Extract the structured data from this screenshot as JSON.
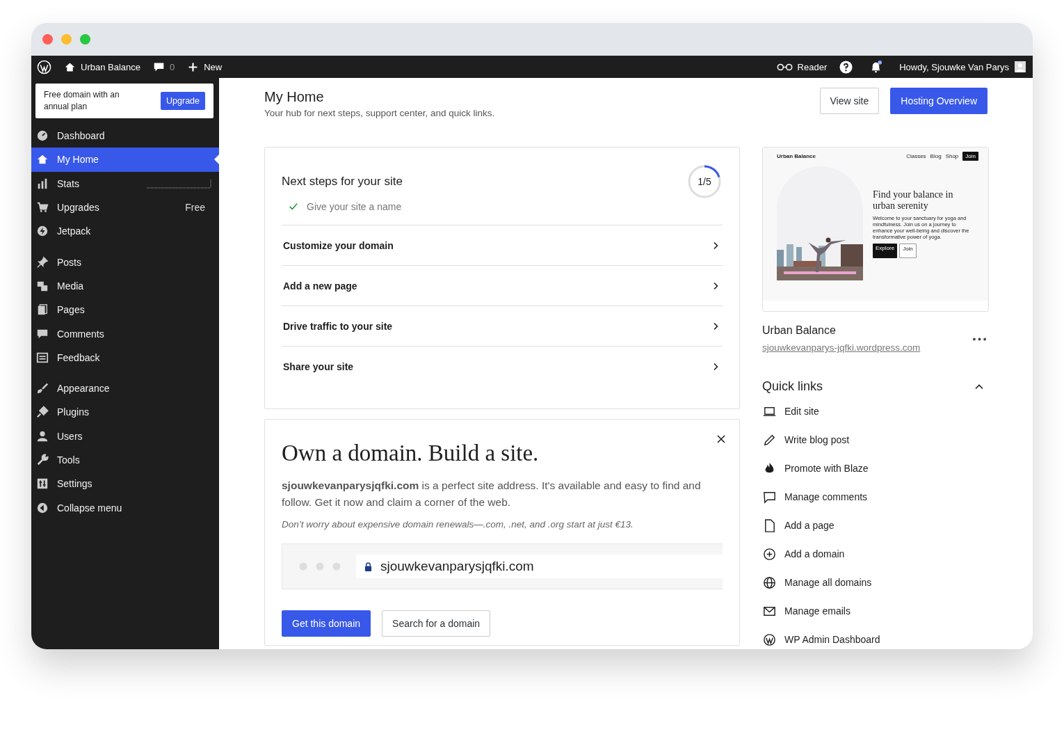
{
  "admin_bar": {
    "site": "Urban Balance",
    "comments": "0",
    "new": "New",
    "reader": "Reader",
    "greeting": "Howdy, Sjouwke Van Parys",
    "unread_notifications": true
  },
  "sidebar": {
    "promo": {
      "text": "Free domain with an annual plan",
      "button": "Upgrade"
    },
    "groups": [
      {
        "items": [
          {
            "label": "Dashboard",
            "selected": false,
            "kind": "plain"
          },
          {
            "label": "My Home",
            "selected": true,
            "kind": "plain"
          },
          {
            "label": "Stats",
            "selected": false,
            "kind": "sparkline"
          },
          {
            "label": "Upgrades",
            "selected": false,
            "kind": "badge",
            "badge": "Free"
          },
          {
            "label": "Jetpack",
            "selected": false,
            "kind": "plain"
          }
        ]
      },
      {
        "items": [
          {
            "label": "Posts",
            "selected": false,
            "kind": "plain"
          },
          {
            "label": "Media",
            "selected": false,
            "kind": "plain"
          },
          {
            "label": "Pages",
            "selected": false,
            "kind": "plain"
          },
          {
            "label": "Comments",
            "selected": false,
            "kind": "plain"
          },
          {
            "label": "Feedback",
            "selected": false,
            "kind": "plain"
          }
        ]
      },
      {
        "items": [
          {
            "label": "Appearance",
            "selected": false,
            "kind": "plain"
          },
          {
            "label": "Plugins",
            "selected": false,
            "kind": "plain"
          },
          {
            "label": "Users",
            "selected": false,
            "kind": "plain"
          },
          {
            "label": "Tools",
            "selected": false,
            "kind": "plain"
          },
          {
            "label": "Settings",
            "selected": false,
            "kind": "plain"
          },
          {
            "label": "Collapse menu",
            "selected": false,
            "kind": "plain"
          }
        ]
      }
    ]
  },
  "header": {
    "title": "My Home",
    "subtitle": "Your hub for next steps, support center, and quick links.",
    "buttons": [
      {
        "label": "View site",
        "primary": false
      },
      {
        "label": "Hosting Overview",
        "primary": true
      }
    ]
  },
  "next_steps": {
    "title": "Next steps for your site",
    "progress": "1/5",
    "level": 0.2,
    "completed": [
      {
        "label": "Give your site a name"
      }
    ],
    "steps": [
      {
        "label": "Customize your domain"
      },
      {
        "label": "Add a new page"
      },
      {
        "label": "Drive traffic to your site"
      },
      {
        "label": "Share your site"
      }
    ]
  },
  "domain_card": {
    "title": "Own a domain. Build a site.",
    "text": "**sjouwkevanparysjqfki.com** is a perfect site address. It's available and easy to find and follow. Get it now and claim a corner of the web.",
    "note": "Don’t worry about expensive domain renewals—.com, .net, and .org start at just €13.",
    "address": "sjouwkevanparysjqfki.com",
    "buttons": [
      {
        "label": "Get this domain",
        "primary": true
      },
      {
        "label": "Search for a domain",
        "primary": false
      }
    ]
  },
  "site_card": {
    "preview": {
      "brand": "Urban Balance",
      "nav": [
        "Classes",
        "Blog",
        "Shop"
      ],
      "nav_button": "Join",
      "headline": "Find your balance in urban serenity",
      "body": "Welcome to your sanctuary for yoga and mindfulness. Join us on a journey to enhance your well-being and discover the transformative power of yoga.",
      "buttons": [
        {
          "label": "Explore",
          "primary": true
        },
        {
          "label": "Join",
          "primary": false
        }
      ]
    },
    "name": "Urban Balance",
    "url": "sjouwkevanparys-jqfki.wordpress.com"
  },
  "quick_links": {
    "title": "Quick links",
    "expanded": true,
    "items": [
      {
        "label": "Edit site"
      },
      {
        "label": "Write blog post"
      },
      {
        "label": "Promote with Blaze"
      },
      {
        "label": "Manage comments"
      },
      {
        "label": "Add a page"
      },
      {
        "label": "Add a domain"
      },
      {
        "label": "Manage all domains"
      },
      {
        "label": "Manage emails"
      },
      {
        "label": "WP Admin Dashboard"
      }
    ]
  }
}
